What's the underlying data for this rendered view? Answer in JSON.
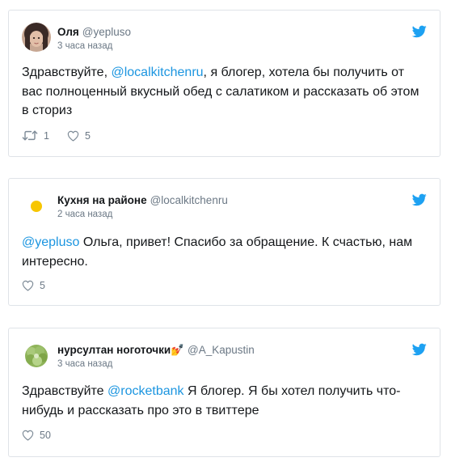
{
  "tweets": [
    {
      "display_name": "Оля",
      "handle": "@yepluso",
      "time": "3 часа назад",
      "text_before": "Здравствуйте, ",
      "mention": "@localkitchenru",
      "text_after": ", я блогер, хотела бы получить от вас полноценный вкусный обед с салатиком и рассказать об этом в сториз",
      "retweets": "1",
      "likes": "5"
    },
    {
      "display_name": "Кухня на районе",
      "handle": "@localkitchenru",
      "time": "2 часа назад",
      "text_before": "",
      "mention": "@yepluso",
      "text_after": " Ольга, привет! Спасибо за обращение. К счастью, нам интересно.",
      "likes": "5"
    },
    {
      "display_name": "нурсултан ноготочки💅",
      "handle": "@A_Kapustin",
      "time": "3 часа назад",
      "text_before": "Здравствуйте ",
      "mention": "@rocketbank",
      "text_after": " Я блогер. Я бы хотел получить что-нибудь и рассказать про это в твиттере",
      "likes": "50"
    }
  ],
  "icons": {
    "logo": "twitter-bird-icon",
    "retweet": "retweet-icon",
    "like": "heart-icon"
  },
  "colors": {
    "link": "#1b95e0",
    "bird": "#1da1f2",
    "meta": "#6b7885",
    "border": "#dfe3e8"
  }
}
